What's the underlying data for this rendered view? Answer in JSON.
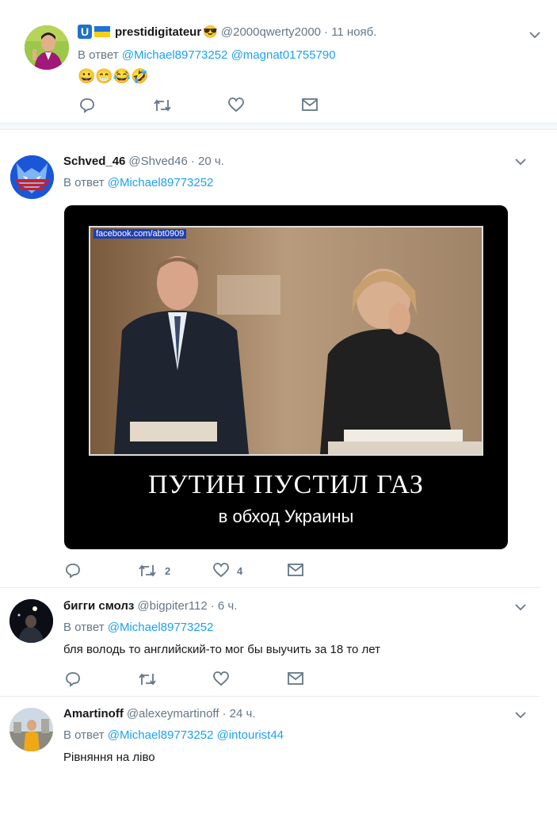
{
  "tweets": [
    {
      "name": "prestidigitateur",
      "handle": "@2000qwerty2000",
      "time": "· 11 нояб.",
      "reply_prefix": "В ответ",
      "mentions": [
        "@Michael89773252",
        "@magnat01755790"
      ],
      "text": "😀😁😂🤣",
      "name_badges": [
        "U",
        "🇺🇦"
      ],
      "name_emoji": "😎",
      "avatar_icon": "man-avatar-icon",
      "actions": {
        "reply": "",
        "retweet": "",
        "like": ""
      }
    },
    {
      "name": "Schved_46",
      "handle": "@Shved46",
      "time": "· 20 ч.",
      "reply_prefix": "В ответ",
      "mentions": [
        "@Michael89773252"
      ],
      "text": "",
      "avatar_icon": "wolf-avatar-icon",
      "image": {
        "watermark": "facebook.com/abt0909",
        "caption_line1": "ПУТИН ПУСТИЛ ГАЗ",
        "caption_line2": "в обход Украины"
      },
      "actions": {
        "reply": "",
        "retweet": "2",
        "like": "4"
      }
    },
    {
      "name": "бигги смолз",
      "handle": "@bigpiter112",
      "time": "· 6 ч.",
      "reply_prefix": "В ответ",
      "mentions": [
        "@Michael89773252"
      ],
      "text": "бля володь то английский-то мог бы выучить за 18 то лет",
      "avatar_icon": "dark-avatar-icon",
      "actions": {
        "reply": "",
        "retweet": "",
        "like": ""
      }
    },
    {
      "name": "Amartinoff",
      "handle": "@alexeymartinoff",
      "time": "· 24 ч.",
      "reply_prefix": "В ответ",
      "mentions": [
        "@Michael89773252",
        "@intourist44"
      ],
      "text": "Рівняння на ліво",
      "avatar_icon": "person-avatar-icon"
    }
  ],
  "colors": {
    "accent": "#1da1f2",
    "muted": "#657786",
    "divider": "#e6ecf0"
  }
}
